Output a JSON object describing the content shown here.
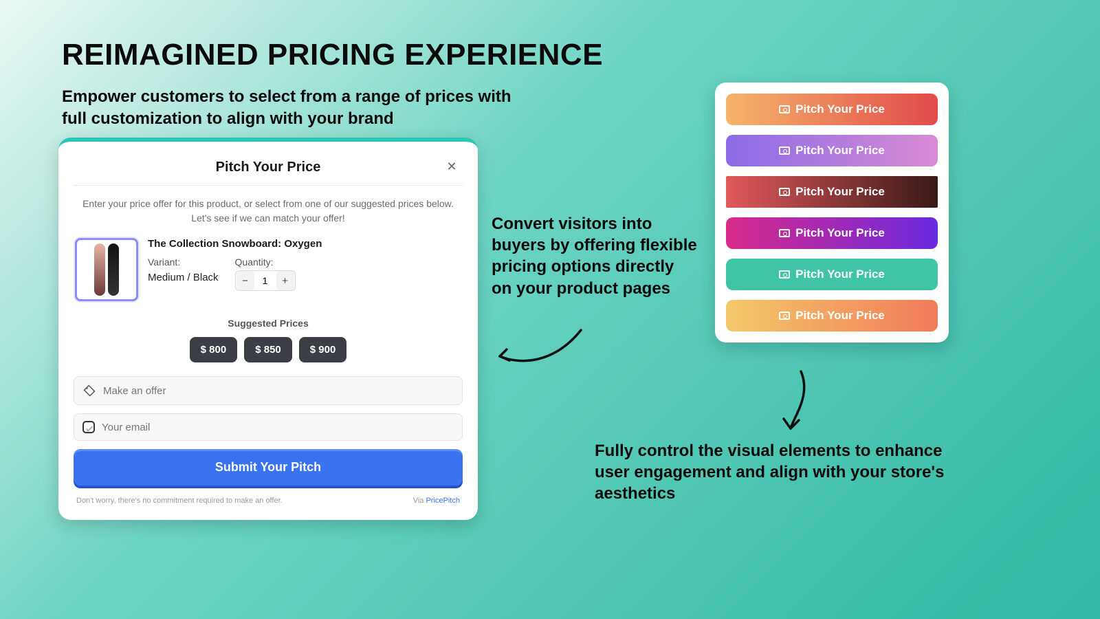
{
  "headline": "REIMAGINED PRICING EXPERIENCE",
  "subhead": "Empower customers to select from a range of prices with full customization to align with your brand",
  "callouts": {
    "convert": "Convert visitors into buyers by offering flexible pricing options directly on your product pages",
    "control": "Fully control the visual elements to enhance user engagement and align with your store's aesthetics"
  },
  "modal": {
    "title": "Pitch Your Price",
    "description": "Enter your price offer for this product, or select from one of our suggested prices below. Let's see if we can match your offer!",
    "product_name": "The Collection Snowboard: Oxygen",
    "variant_label": "Variant:",
    "variant_value": "Medium / Black",
    "quantity_label": "Quantity:",
    "quantity_value": "1",
    "suggested_label": "Suggested Prices",
    "suggested": [
      "$ 800",
      "$ 850",
      "$ 900"
    ],
    "offer_placeholder": "Make an offer",
    "email_placeholder": "Your email",
    "submit_label": "Submit Your Pitch",
    "disclaimer": "Don't worry, there's no commitment required to make an offer.",
    "via_prefix": "Via ",
    "via_link": "PricePitch"
  },
  "showcase": {
    "label": "Pitch Your Price"
  }
}
